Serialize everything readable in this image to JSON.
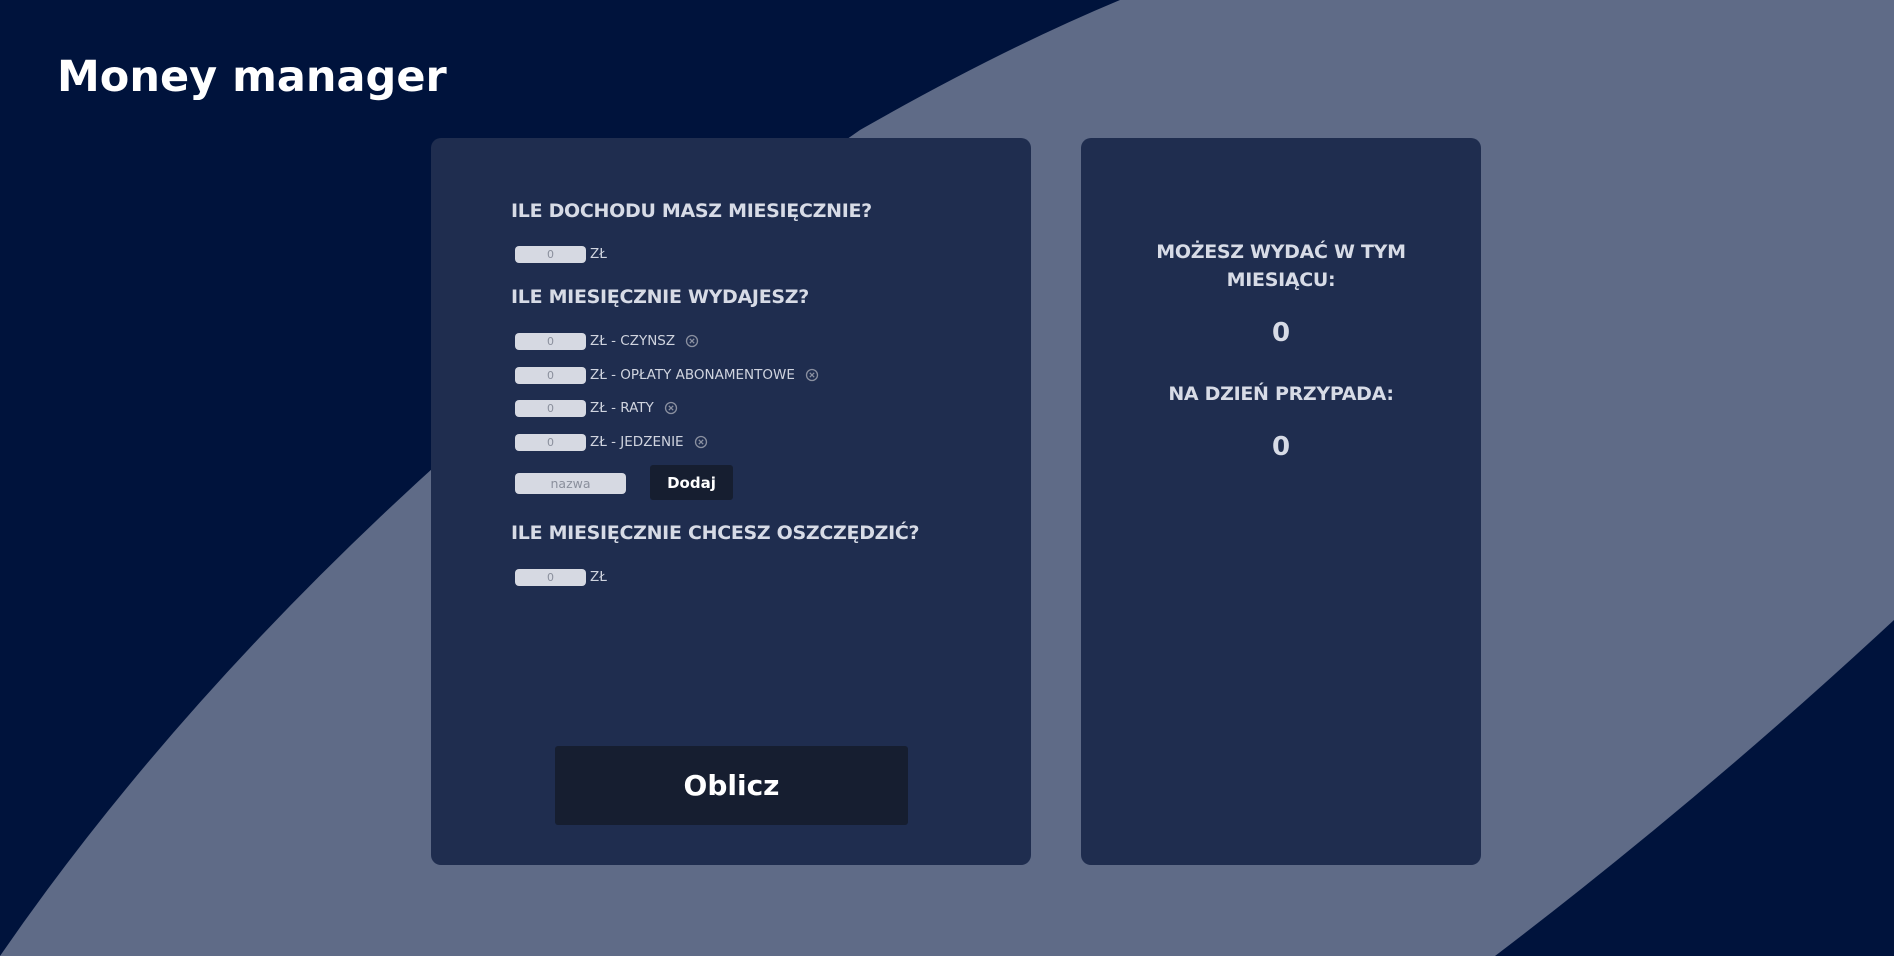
{
  "app": {
    "title": "Money manager"
  },
  "colors": {
    "background_dark": "#00133c",
    "background_swoosh": "#5f6b87",
    "card": "#1f2d4f",
    "button": "#161e30",
    "input": "#d6d9e2"
  },
  "form": {
    "income": {
      "heading": "ILE DOCHODU MASZ MIESIĘCZNIE?",
      "value": "0",
      "unit": "ZŁ"
    },
    "expenses": {
      "heading": "ILE MIESIĘCZNIE WYDAJESZ?",
      "items": [
        {
          "value": "0",
          "label": "ZŁ - CZYNSZ",
          "remove_icon": "circle-x-icon"
        },
        {
          "value": "0",
          "label": "ZŁ - OPŁATY ABONAMENTOWE",
          "remove_icon": "circle-x-icon"
        },
        {
          "value": "0",
          "label": "ZŁ - RATY",
          "remove_icon": "circle-x-icon"
        },
        {
          "value": "0",
          "label": "ZŁ - JEDZENIE",
          "remove_icon": "circle-x-icon"
        }
      ],
      "new_item_placeholder": "nazwa",
      "add_label": "Dodaj"
    },
    "savings": {
      "heading": "ILE MIESIĘCZNIE CHCESZ OSZCZĘDZIĆ?",
      "value": "0",
      "unit": "ZŁ"
    },
    "calculate_label": "Oblicz"
  },
  "result": {
    "monthly_heading": "MOŻESZ WYDAĆ W TYM MIESIĄCU:",
    "monthly_value": "0",
    "daily_heading": "NA DZIEŃ PRZYPADA:",
    "daily_value": "0"
  }
}
